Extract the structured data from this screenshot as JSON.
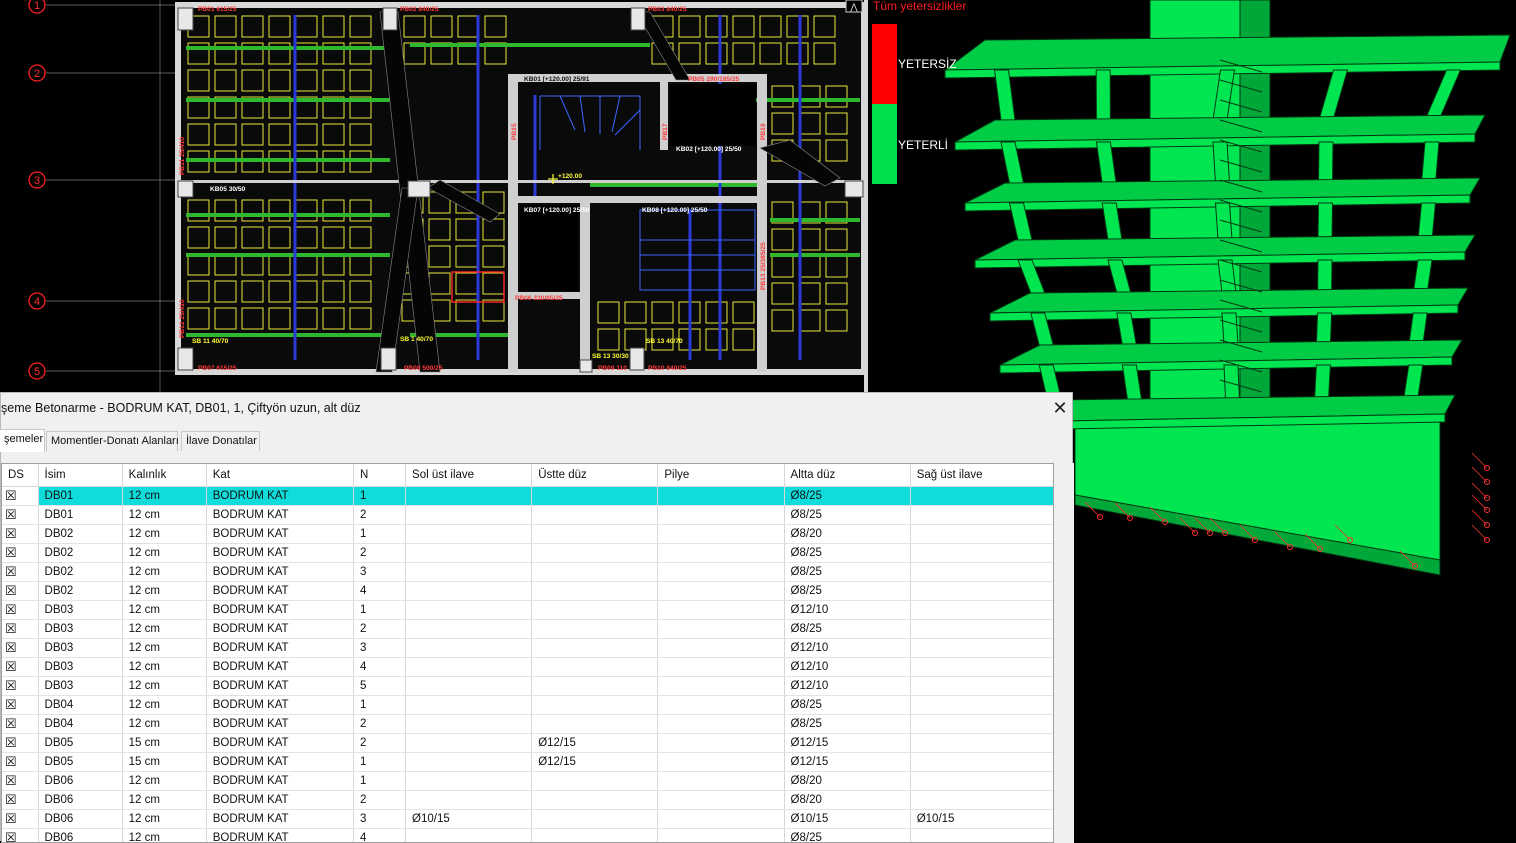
{
  "legend": {
    "title": "Tüm yetersizlikler",
    "insufficient_label": "YETERSİZ",
    "sufficient_label": "YETERLİ",
    "insufficient_color": "#ff0000",
    "sufficient_color": "#00e04b"
  },
  "plan": {
    "axis_labels": [
      "1",
      "2",
      "3",
      "4",
      "5"
    ],
    "labels": {
      "pb01": "PB01  615/25",
      "pb02": "PB02  840/25",
      "pb03": "PB03  840/25",
      "pb05": "PB05  290/185/25",
      "pb06": "PB06  220/85/25",
      "pb07": "PB07  615/25",
      "pb08": "PB08  500/25",
      "pb09": "PB09 110",
      "pb10": "PB10  840/25",
      "kb01": "KB01 [+120.00]  25/91",
      "kb02": "KB02 [+120.00]  25/50",
      "kb05": "KB05  30/50",
      "kb07": "KB07 [+120.00]  25/50",
      "kb08": "KB08 [+120.00]  25/50",
      "kot": "+120.00",
      "pb11": "PB11  25/410",
      "pb12": "PB12  25/410",
      "pb13": "PB13  25/385/25",
      "pb15": "PB15",
      "pb17": "PB17",
      "pb19": "PB19",
      "sb1": "SB 1 40/70",
      "sb11": "SB 11 40/70",
      "sb13": "SB 13  40/70",
      "sb15": "SB 13 30/30"
    }
  },
  "dialog": {
    "title": "şeme Betonarme - BODRUM KAT, DB01, 1, Çiftyön uzun, alt düz",
    "close_glyph": "✕",
    "tabs": [
      "şemeler",
      "Momentler-Donatı Alanları",
      "İlave Donatılar"
    ],
    "columns": [
      "DS",
      "İsim",
      "Kalınlık",
      "Kat",
      "N",
      "Sol üst ilave",
      "Üstte düz",
      "Pilye",
      "Altta düz",
      "Sağ üst ilave"
    ],
    "rows": [
      [
        "☒",
        "DB01",
        "12 cm",
        "BODRUM KAT",
        "1",
        "",
        "",
        "",
        "Ø8/25",
        ""
      ],
      [
        "☒",
        "DB01",
        "12 cm",
        "BODRUM KAT",
        "2",
        "",
        "",
        "",
        "Ø8/25",
        ""
      ],
      [
        "☒",
        "DB02",
        "12 cm",
        "BODRUM KAT",
        "1",
        "",
        "",
        "",
        "Ø8/20",
        ""
      ],
      [
        "☒",
        "DB02",
        "12 cm",
        "BODRUM KAT",
        "2",
        "",
        "",
        "",
        "Ø8/25",
        ""
      ],
      [
        "☒",
        "DB02",
        "12 cm",
        "BODRUM KAT",
        "3",
        "",
        "",
        "",
        "Ø8/25",
        ""
      ],
      [
        "☒",
        "DB02",
        "12 cm",
        "BODRUM KAT",
        "4",
        "",
        "",
        "",
        "Ø8/25",
        ""
      ],
      [
        "☒",
        "DB03",
        "12 cm",
        "BODRUM KAT",
        "1",
        "",
        "",
        "",
        "Ø12/10",
        ""
      ],
      [
        "☒",
        "DB03",
        "12 cm",
        "BODRUM KAT",
        "2",
        "",
        "",
        "",
        "Ø8/25",
        ""
      ],
      [
        "☒",
        "DB03",
        "12 cm",
        "BODRUM KAT",
        "3",
        "",
        "",
        "",
        "Ø12/10",
        ""
      ],
      [
        "☒",
        "DB03",
        "12 cm",
        "BODRUM KAT",
        "4",
        "",
        "",
        "",
        "Ø12/10",
        ""
      ],
      [
        "☒",
        "DB03",
        "12 cm",
        "BODRUM KAT",
        "5",
        "",
        "",
        "",
        "Ø12/10",
        ""
      ],
      [
        "☒",
        "DB04",
        "12 cm",
        "BODRUM KAT",
        "1",
        "",
        "",
        "",
        "Ø8/25",
        ""
      ],
      [
        "☒",
        "DB04",
        "12 cm",
        "BODRUM KAT",
        "2",
        "",
        "",
        "",
        "Ø8/25",
        ""
      ],
      [
        "☒",
        "DB05",
        "15 cm",
        "BODRUM KAT",
        "2",
        "",
        "Ø12/15",
        "",
        "Ø12/15",
        ""
      ],
      [
        "☒",
        "DB05",
        "15 cm",
        "BODRUM KAT",
        "1",
        "",
        "Ø12/15",
        "",
        "Ø12/15",
        ""
      ],
      [
        "☒",
        "DB06",
        "12 cm",
        "BODRUM KAT",
        "1",
        "",
        "",
        "",
        "Ø8/20",
        ""
      ],
      [
        "☒",
        "DB06",
        "12 cm",
        "BODRUM KAT",
        "2",
        "",
        "",
        "",
        "Ø8/20",
        ""
      ],
      [
        "☒",
        "DB06",
        "12 cm",
        "BODRUM KAT",
        "3",
        "Ø10/15",
        "",
        "",
        "Ø10/15",
        "Ø10/15"
      ],
      [
        "☒",
        "DB06",
        "12 cm",
        "BODRUM KAT",
        "4",
        "",
        "",
        "",
        "Ø8/25",
        ""
      ]
    ],
    "selected_row": 0
  }
}
